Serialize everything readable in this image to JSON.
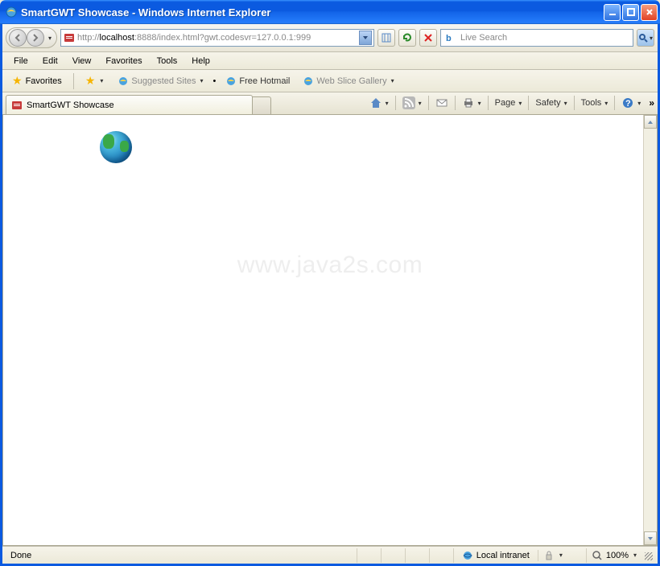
{
  "window": {
    "title": "SmartGWT Showcase - Windows Internet Explorer"
  },
  "nav": {
    "url_prefix": "http://",
    "url_host": "localhost",
    "url_rest": ":8888/index.html?gwt.codesvr=127.0.0.1:999",
    "search_placeholder": "Live Search"
  },
  "menu": {
    "file": "File",
    "edit": "Edit",
    "view": "View",
    "favorites": "Favorites",
    "tools": "Tools",
    "help": "Help"
  },
  "links": {
    "favorites": "Favorites",
    "suggested": "Suggested Sites",
    "hotmail": "Free Hotmail",
    "webslice": "Web Slice Gallery"
  },
  "tab": {
    "title": "SmartGWT Showcase"
  },
  "commands": {
    "page": "Page",
    "safety": "Safety",
    "tools": "Tools"
  },
  "watermark": "www.java2s.com",
  "status": {
    "done": "Done",
    "zone": "Local intranet",
    "zoom": "100%"
  }
}
